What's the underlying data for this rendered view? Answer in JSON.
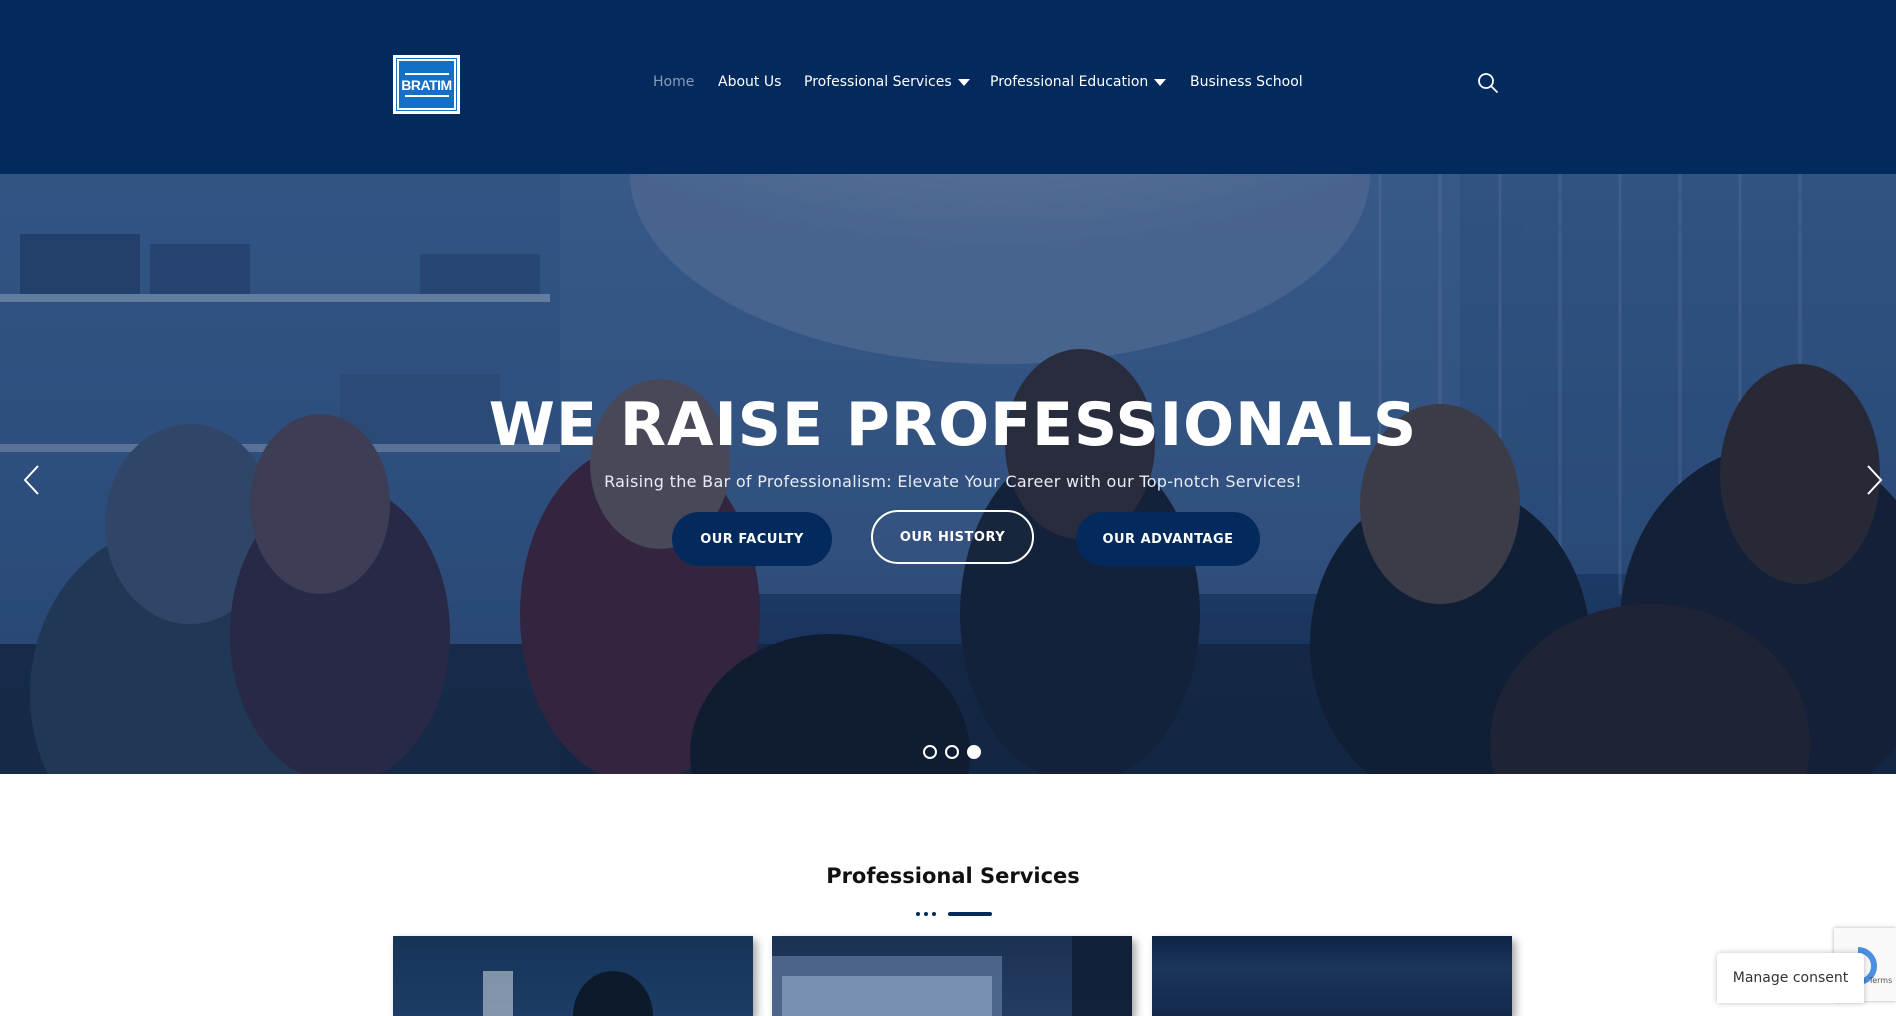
{
  "header": {
    "logo_text": "BRATIM",
    "nav": [
      {
        "label": "Home",
        "active": true
      },
      {
        "label": "About Us"
      },
      {
        "label": "Professional Services",
        "dropdown": true
      },
      {
        "label": "Professional Education",
        "dropdown": true
      },
      {
        "label": "Business School"
      }
    ],
    "search_icon": "search-icon"
  },
  "hero": {
    "title": "WE RAISE PROFESSIONALS",
    "subtitle": "Raising the Bar of Professionalism: Elevate Your Career with our Top-notch Services!",
    "buttons": [
      "OUR FACULTY",
      "OUR HISTORY",
      "OUR ADVANTAGE"
    ],
    "slides_total": 3,
    "active_slide": 3
  },
  "section": {
    "title_light": "Professional",
    "title_bold": "Services"
  },
  "consent": {
    "label": "Manage consent"
  },
  "recaptcha": {
    "text": "y - Terms"
  },
  "colors": {
    "navy": "#022a5c",
    "logo_blue": "#1370c6"
  }
}
